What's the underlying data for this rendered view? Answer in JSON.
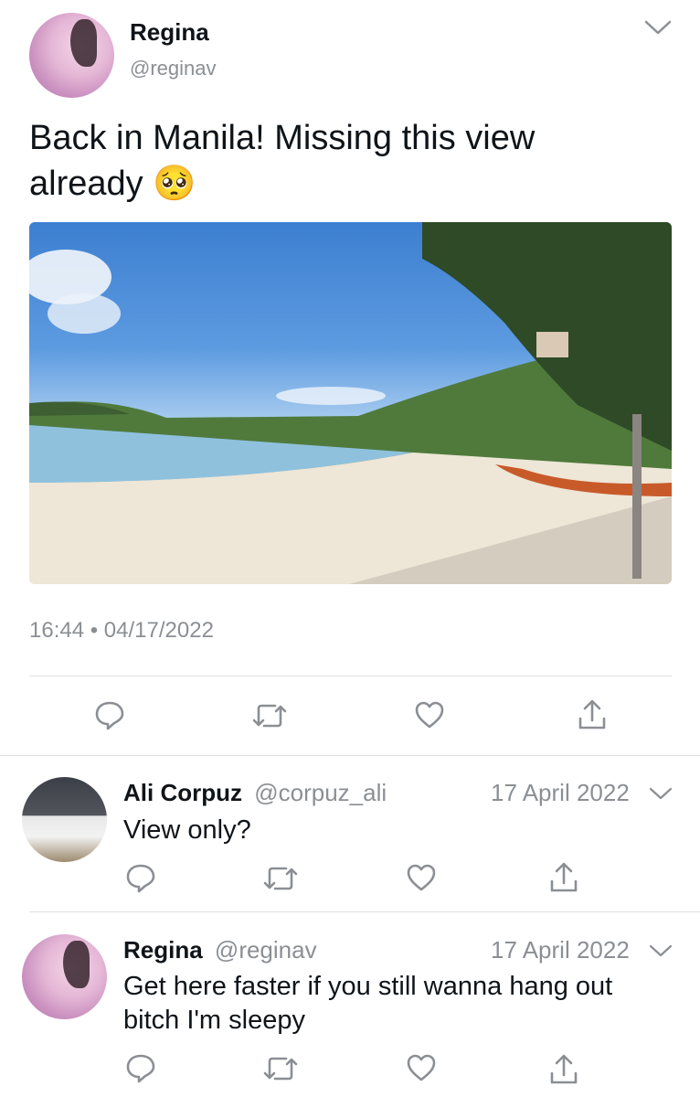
{
  "tweet": {
    "author_name": "Regina",
    "author_handle": "@reginav",
    "text": "Back in Manila! Missing this view already 🥺",
    "timestamp": "16:44 • 04/17/2022"
  },
  "replies": [
    {
      "author_name": "Ali Corpuz",
      "author_handle": "@corpuz_ali",
      "date": "17 April 2022",
      "text": "View only?"
    },
    {
      "author_name": "Regina",
      "author_handle": "@reginav",
      "date": "17 April 2022",
      "text": "Get here faster if you still wanna hang out bitch I'm sleepy"
    }
  ],
  "icons": [
    "chevron-down-icon",
    "reply-icon",
    "retweet-icon",
    "like-icon",
    "share-icon"
  ],
  "colors": {
    "icon": "#8b8f94",
    "divider": "#dcdfe2",
    "text": "#0f1419"
  }
}
